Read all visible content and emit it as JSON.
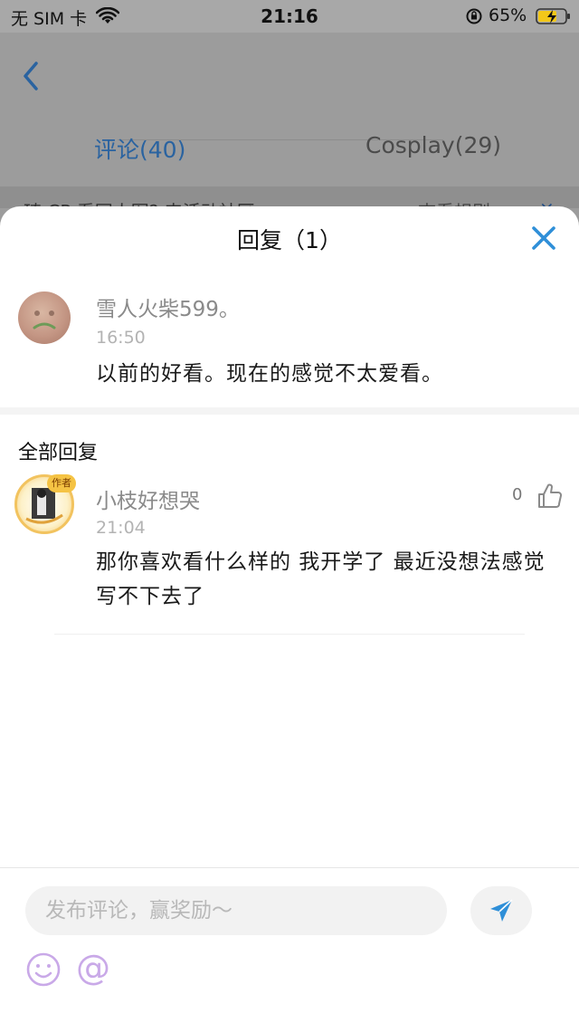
{
  "status_bar": {
    "carrier": "无 SIM 卡",
    "time": "21:16",
    "battery": "65%"
  },
  "background": {
    "tabs": [
      {
        "label": "评论(40)",
        "active": true
      },
      {
        "label": "Cosplay(29)",
        "active": false
      }
    ],
    "notice": {
      "text": "琦 CP 看同人图? 来活动社区",
      "link": "查看规则 ›",
      "close": "×"
    }
  },
  "sheet": {
    "title": "回复（1）",
    "main_comment": {
      "username": "雪人火柴599。",
      "time": "16:50",
      "content": "以前的好看。现在的感觉不太爱看。"
    },
    "section_title": "全部回复",
    "replies": [
      {
        "username": "小枝好想哭",
        "time": "21:04",
        "content": "那你喜欢看什么样的 我开学了 最近没想法感觉写不下去了",
        "likes": "0",
        "badge": "作者"
      }
    ]
  },
  "composer": {
    "placeholder": "发布评论，赢奖励～",
    "at_symbol": "@"
  },
  "colors": {
    "accent": "#2f8fd8",
    "dim_overlay": "#9c9c9c",
    "placeholder": "#b8b8b8",
    "emoji": "#c9a9e8"
  },
  "icons": {
    "back": "back-arrow-icon",
    "close": "close-icon",
    "like": "thumbs-up-icon",
    "send": "send-icon",
    "emoji": "emoji-icon"
  }
}
